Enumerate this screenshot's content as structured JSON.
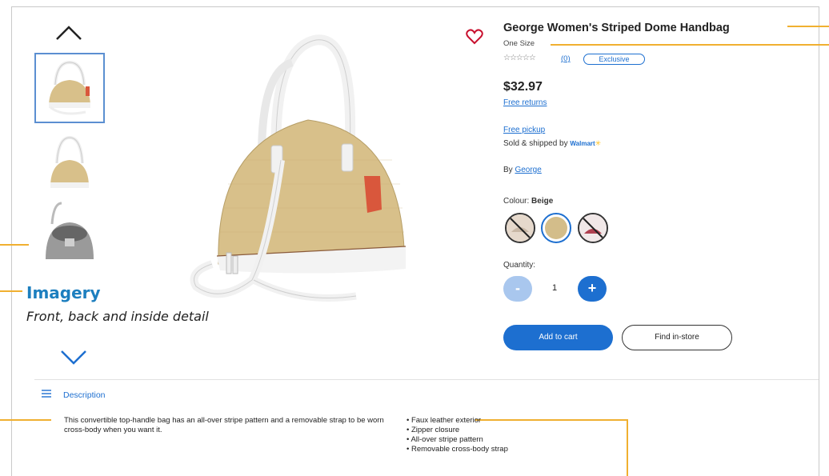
{
  "annotation": {
    "title": "Imagery",
    "subtitle": "Front, back and inside detail"
  },
  "product": {
    "title": "George Women's Striped Dome Handbag",
    "size": "One Size",
    "stars": "☆☆☆☆☆",
    "review_count": "(0)",
    "badge": "Exclusive",
    "price": "$32.97",
    "free_returns": "Free returns",
    "free_pickup": "Free pickup",
    "sold_by_prefix": "Sold & shipped by",
    "sold_by_name": "Walmart",
    "by_prefix": "By",
    "brand": "George",
    "colour_label": "Colour:",
    "colour_value": "Beige",
    "quantity_label": "Quantity:",
    "quantity_value": "1",
    "minus_label": "-",
    "plus_label": "+",
    "add_to_cart": "Add to cart",
    "find_in_store": "Find in-store"
  },
  "description": {
    "heading": "Description",
    "body": "This convertible top-handle bag has an all-over stripe pattern and a removable strap to be worn cross-body when you want it.",
    "features": [
      "• Faux leather exterior",
      "• Zipper closure",
      "• All-over stripe pattern",
      "• Removable cross-body strap"
    ]
  },
  "colors": {
    "accent": "#1d6fd0",
    "annotation": "#f0b030",
    "bag_body": "#d8c08a",
    "bag_trim": "#f2f2f2",
    "tag": "#d9573c"
  }
}
